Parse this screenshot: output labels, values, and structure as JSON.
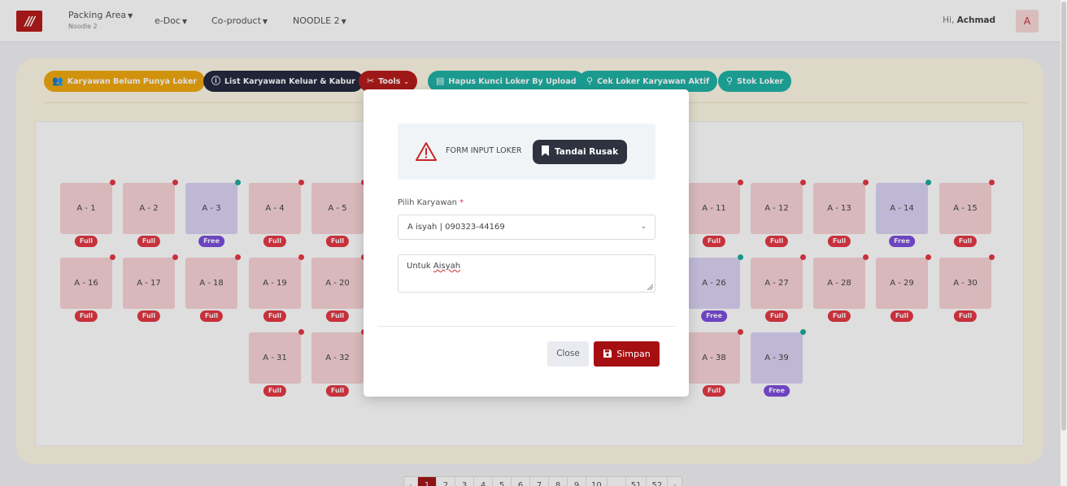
{
  "navbar": {
    "logo": "///",
    "items": [
      {
        "label": "Packing Area",
        "sub": "Noodle 2"
      },
      {
        "label": "e-Doc"
      },
      {
        "label": "Co-product"
      },
      {
        "label": "NOODLE 2"
      }
    ],
    "greeting_prefix": "Hi,",
    "user_name": "Achmad",
    "avatar_letter": "A"
  },
  "toolbar": {
    "buttons": [
      {
        "label": "Karyawan Belum Punya Loker",
        "icon": "users-icon",
        "color": "#f0a80f"
      },
      {
        "label": "List Karyawan Keluar & Kabur",
        "icon": "info-icon",
        "color": "#252a3e"
      },
      {
        "label": "Tools",
        "icon": "tools-icon",
        "color": "#b71c1c"
      },
      {
        "label": "Hapus Kunci Loker By Upload",
        "icon": "excel-file-icon",
        "color": "#20b2a6"
      },
      {
        "label": "Cek Loker Karyawan Aktif",
        "icon": "search-icon",
        "color": "#20b2a6"
      },
      {
        "label": "Stok Loker",
        "icon": "search-icon",
        "color": "#20b2a6"
      }
    ]
  },
  "lockers": {
    "status_labels": {
      "full": "Full",
      "free": "Free"
    },
    "items": [
      {
        "name": "A - 1",
        "status": "full"
      },
      {
        "name": "A - 2",
        "status": "full"
      },
      {
        "name": "A - 3",
        "status": "free"
      },
      {
        "name": "A - 4",
        "status": "full"
      },
      {
        "name": "A - 5",
        "status": "full"
      },
      {
        "name": "A - 11",
        "status": "full"
      },
      {
        "name": "A - 12",
        "status": "full"
      },
      {
        "name": "A - 13",
        "status": "full"
      },
      {
        "name": "A - 14",
        "status": "free"
      },
      {
        "name": "A - 15",
        "status": "full"
      },
      {
        "name": "A - 16",
        "status": "full"
      },
      {
        "name": "A - 17",
        "status": "full"
      },
      {
        "name": "A - 18",
        "status": "full"
      },
      {
        "name": "A - 19",
        "status": "full"
      },
      {
        "name": "A - 20",
        "status": "full"
      },
      {
        "name": "A - 26",
        "status": "free"
      },
      {
        "name": "A - 27",
        "status": "full"
      },
      {
        "name": "A - 28",
        "status": "full"
      },
      {
        "name": "A - 29",
        "status": "full"
      },
      {
        "name": "A - 30",
        "status": "full"
      },
      {
        "name": "A - 31",
        "status": "full"
      },
      {
        "name": "A - 32",
        "status": "full"
      },
      {
        "name": "A - 38",
        "status": "full"
      },
      {
        "name": "A - 39",
        "status": "free"
      }
    ]
  },
  "pagination": {
    "prev": "‹",
    "pages": [
      "1",
      "2",
      "3",
      "4",
      "5",
      "6",
      "7",
      "8",
      "9",
      "10",
      "...",
      "51",
      "52"
    ],
    "next": "›",
    "current": "1"
  },
  "modal": {
    "header_title": "FORM INPUT LOKER",
    "mark_damaged_label": "Tandai Rusak",
    "field_label": "Pilih Karyawan",
    "required_mark": "*",
    "selected_employee": "A isyah | 090323-44169",
    "note_prefix": "Untuk ",
    "note_misspelled": "Aisyah",
    "close_label": "Close",
    "save_label": "Simpan"
  }
}
